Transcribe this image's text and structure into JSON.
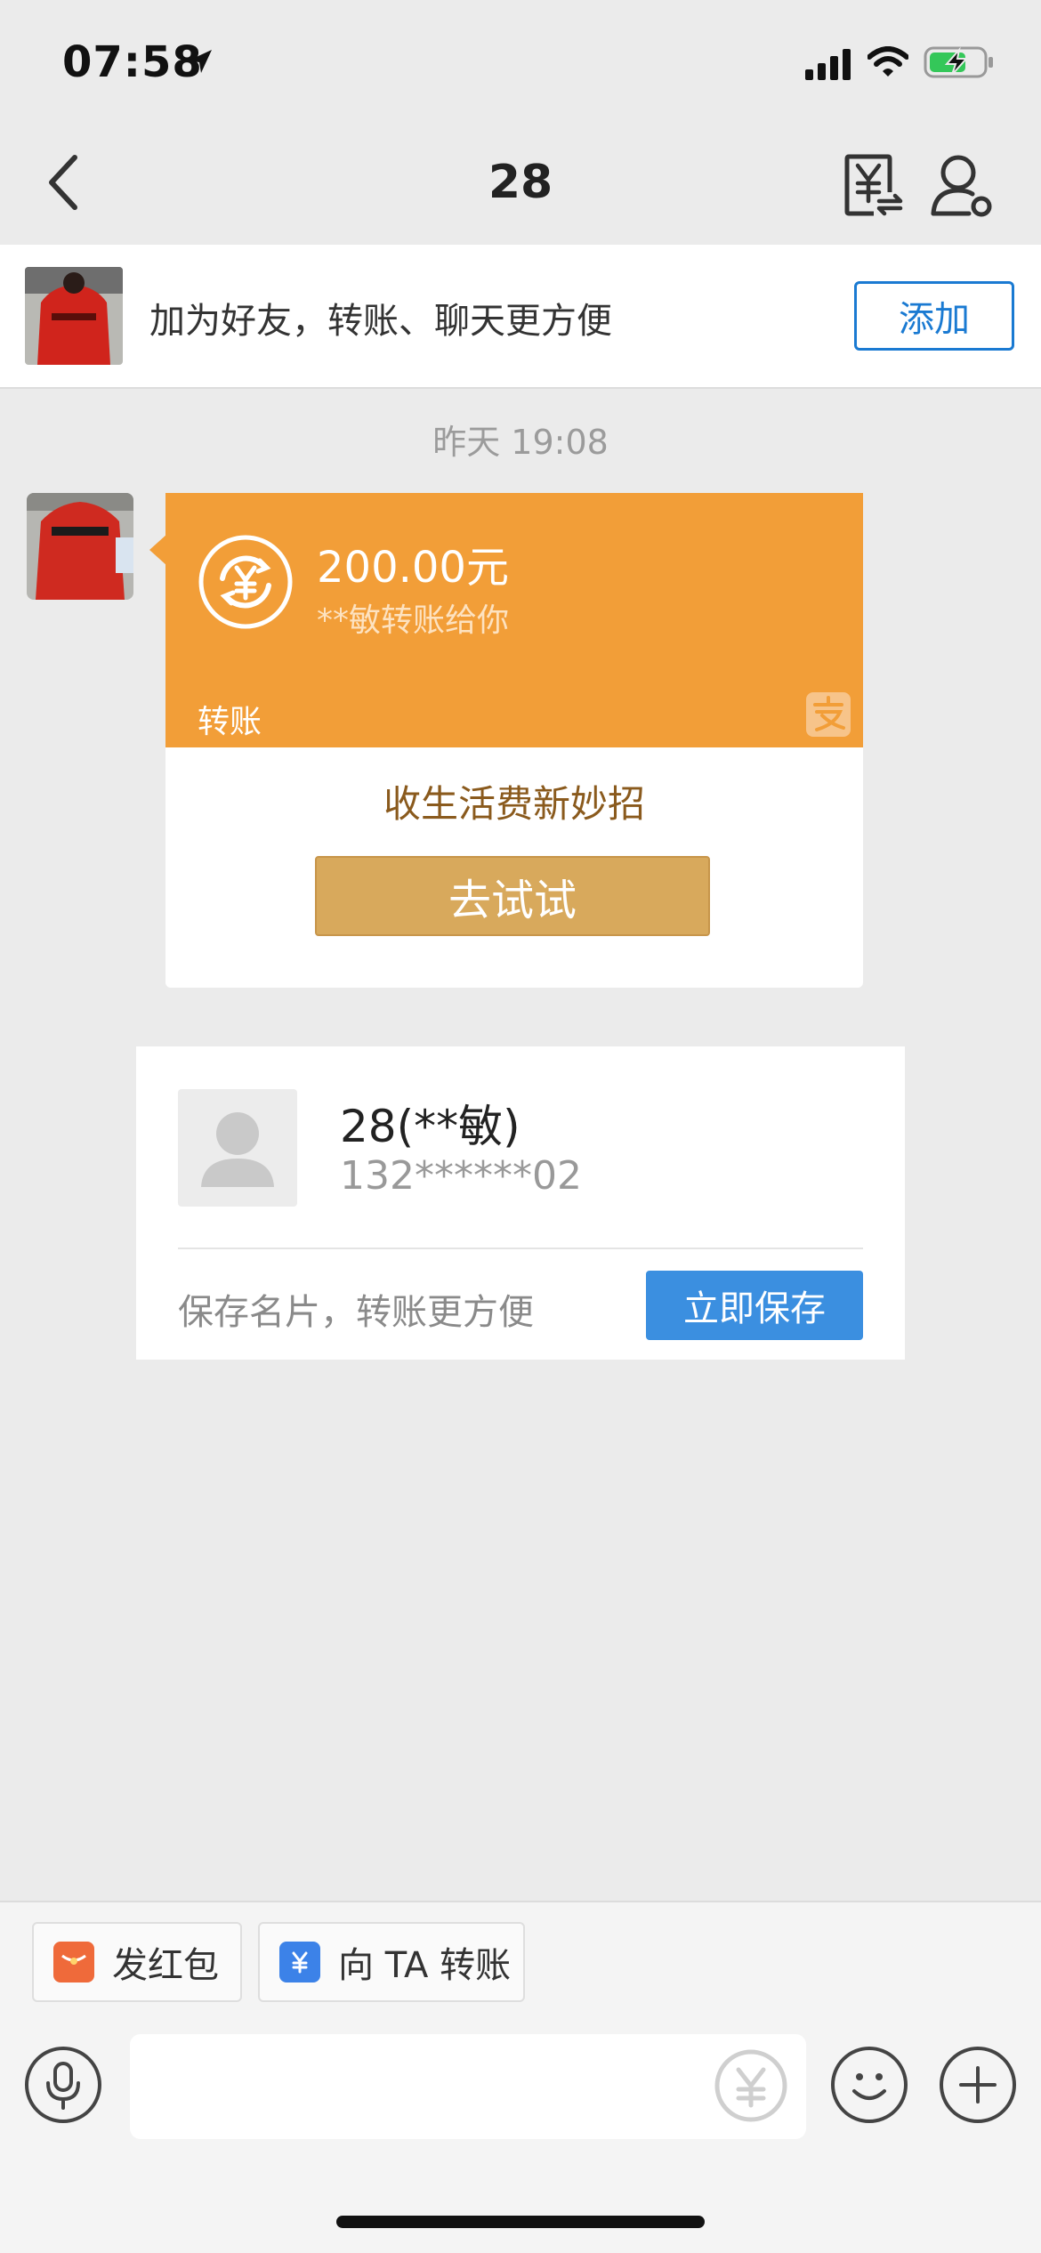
{
  "status_bar": {
    "time": "07:58",
    "icons": [
      "location-arrow-icon",
      "cellular-signal-icon",
      "wifi-icon",
      "battery-charging-icon"
    ]
  },
  "nav": {
    "title": "28",
    "back_icon": "chevron-left-icon",
    "right_icons": [
      "transfer-record-icon",
      "user-settings-icon"
    ]
  },
  "banner": {
    "text": "加为好友，转账、聊天更方便",
    "add_label": "添加"
  },
  "chat": {
    "timestamp": "昨天 19:08",
    "transfer": {
      "amount": "200.00元",
      "description": "**敏转账给你",
      "type_label": "转账",
      "promo_text": "收生活费新妙招",
      "try_label": "去试试"
    },
    "contact_card": {
      "name": "28(**敏)",
      "phone": "132******02",
      "save_hint": "保存名片，转账更方便",
      "save_label": "立即保存"
    }
  },
  "bottom": {
    "quick_actions": [
      {
        "label": "发红包",
        "icon": "red-packet-icon",
        "color": "#ef6a3a"
      },
      {
        "label": "向 TA 转账",
        "icon": "transfer-icon",
        "color": "#3c82e8"
      }
    ],
    "input_placeholder": ""
  },
  "colors": {
    "transfer_orange": "#f29e38",
    "try_button": "#d8a95c",
    "save_button": "#3b8fe0",
    "add_button": "#1a7ad2"
  }
}
